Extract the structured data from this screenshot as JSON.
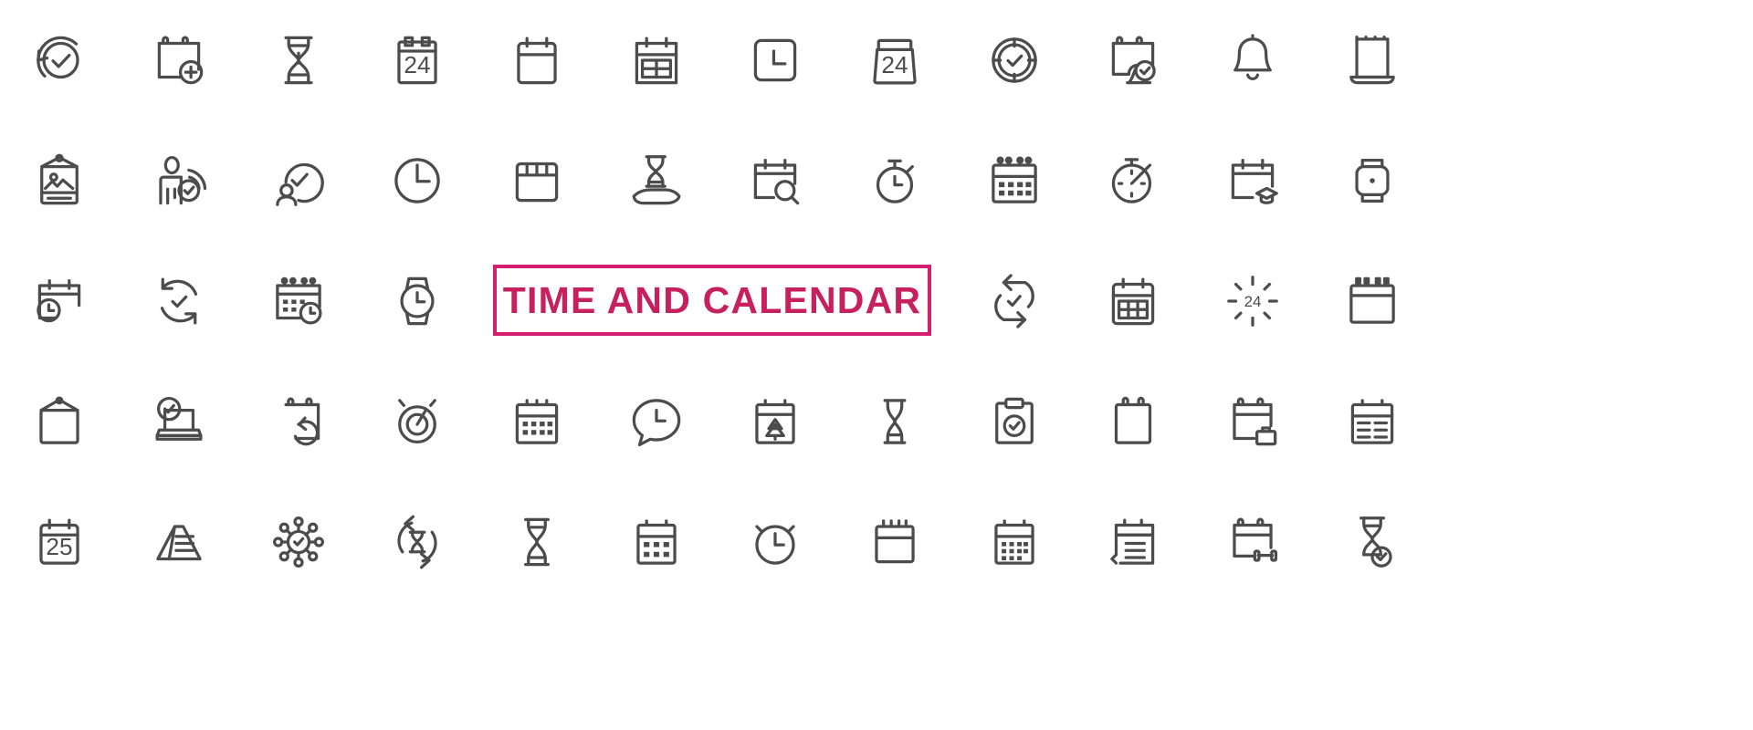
{
  "poster": {
    "title": "TIME AND CALENDAR",
    "title_color": "#c7205f",
    "border_color": "#d51e6f",
    "icon_color": "#4c4c4c",
    "background_color": "#ffffff",
    "columns": 12,
    "rows": 5,
    "total_icons": 54
  },
  "badges": {
    "cal24_a": "24",
    "cal24_b": "24",
    "cal24_c": "24",
    "cal25": "25"
  },
  "rows": [
    {
      "index": 1,
      "icons": [
        {
          "name": "clock-check-refresh-icon",
          "label": "Clock with check and refresh arrow"
        },
        {
          "name": "calendar-add-icon",
          "label": "Calendar page with plus"
        },
        {
          "name": "hourglass-icon",
          "label": "Hourglass"
        },
        {
          "name": "calendar-24-icon",
          "label": "Calendar 24",
          "text": "24"
        },
        {
          "name": "calendar-blank-icon",
          "label": "Blank calendar"
        },
        {
          "name": "calendar-grid-icon",
          "label": "Calendar with grid"
        },
        {
          "name": "clock-square-icon",
          "label": "Square clock"
        },
        {
          "name": "calendar-24-box-icon",
          "label": "Calendar box 24",
          "text": "24"
        },
        {
          "name": "clock-round-check-icon",
          "label": "Round clock with check"
        },
        {
          "name": "calendar-page-check-icon",
          "label": "Calendar page with check badge"
        },
        {
          "name": "bell-icon",
          "label": "Bell"
        },
        {
          "name": "calendar-torn-icon",
          "label": "Torn calendar sheet"
        }
      ]
    },
    {
      "index": 2,
      "icons": [
        {
          "name": "hanging-board-photo-icon",
          "label": "Hanging board with photo"
        },
        {
          "name": "person-presentation-check-icon",
          "label": "Person presentation with check"
        },
        {
          "name": "person-clock-check-icon",
          "label": "Person with clock check"
        },
        {
          "name": "clock-simple-icon",
          "label": "Simple clock"
        },
        {
          "name": "calendar-header-blank-icon",
          "label": "Calendar with header strip"
        },
        {
          "name": "hand-hourglass-icon",
          "label": "Hand holding hourglass"
        },
        {
          "name": "calendar-search-icon",
          "label": "Calendar with magnifier"
        },
        {
          "name": "stopwatch-icon",
          "label": "Stopwatch"
        },
        {
          "name": "calendar-spiral-grid-icon",
          "label": "Spiral calendar with grid"
        },
        {
          "name": "timer-icon",
          "label": "Timer dial"
        },
        {
          "name": "calendar-graduation-icon",
          "label": "Calendar with graduation cap"
        },
        {
          "name": "smartwatch-icon",
          "label": "Smartwatch"
        }
      ]
    },
    {
      "index": 3,
      "icons": [
        {
          "name": "calendar-clock-icon",
          "label": "Calendar with clock"
        },
        {
          "name": "refresh-check-icon",
          "label": "Refresh arrows with check"
        },
        {
          "name": "calendar-schedule-clock-icon",
          "label": "Schedule calendar with clock"
        },
        {
          "name": "watch-icon",
          "label": "Wrist watch"
        },
        {
          "name": "title-banner",
          "label": "TIME AND CALENDAR"
        },
        {
          "name": "arrows-exchange-check-icon",
          "label": "Exchange arrows with check"
        },
        {
          "name": "calendar-grid-month-icon",
          "label": "Month grid calendar"
        },
        {
          "name": "sunburst-24-icon",
          "label": "Sunburst 24 hours",
          "text": "24"
        },
        {
          "name": "calendar-spiral-blank-icon",
          "label": "Spiral blank calendar"
        }
      ]
    },
    {
      "index": 4,
      "icons": [
        {
          "name": "board-hanging-blank-icon",
          "label": "Blank hanging board"
        },
        {
          "name": "laptop-check-icon",
          "label": "Laptop with check badge"
        },
        {
          "name": "calendar-refresh-icon",
          "label": "Calendar with refresh"
        },
        {
          "name": "alarm-dial-icon",
          "label": "Alarm dial"
        },
        {
          "name": "calendar-dots-grid-icon",
          "label": "Calendar with dot grid"
        },
        {
          "name": "chat-clock-icon",
          "label": "Chat bubble with clock"
        },
        {
          "name": "calendar-christmas-icon",
          "label": "Calendar with tree"
        },
        {
          "name": "hourglass-slim-icon",
          "label": "Slim hourglass"
        },
        {
          "name": "clipboard-check-icon",
          "label": "Clipboard with check"
        },
        {
          "name": "notepad-icon",
          "label": "Notepad sheet"
        },
        {
          "name": "calendar-briefcase-icon",
          "label": "Calendar with briefcase"
        },
        {
          "name": "calendar-table-icon",
          "label": "Calendar with table rows"
        }
      ]
    },
    {
      "index": 5,
      "icons": [
        {
          "name": "calendar-25-icon",
          "label": "Calendar 25",
          "text": "25"
        },
        {
          "name": "tent-card-icon",
          "label": "Tent card with lines"
        },
        {
          "name": "network-check-icon",
          "label": "Network nodes with check"
        },
        {
          "name": "hourglass-refresh-icon",
          "label": "Hourglass with refresh arrows"
        },
        {
          "name": "hourglass-classic-icon",
          "label": "Classic hourglass"
        },
        {
          "name": "calendar-dots-icon",
          "label": "Calendar with dots"
        },
        {
          "name": "stopwatch-clock-icon",
          "label": "Stopwatch clock"
        },
        {
          "name": "calendar-top-blank-icon",
          "label": "Calendar blank with top ticks"
        },
        {
          "name": "calendar-dot-rows-icon",
          "label": "Calendar with dot rows"
        },
        {
          "name": "calendar-lines-icon",
          "label": "Calendar with text lines"
        },
        {
          "name": "calendar-dumbbell-icon",
          "label": "Calendar with dumbbell"
        },
        {
          "name": "hourglass-check-icon",
          "label": "Hourglass with check"
        }
      ]
    }
  ]
}
